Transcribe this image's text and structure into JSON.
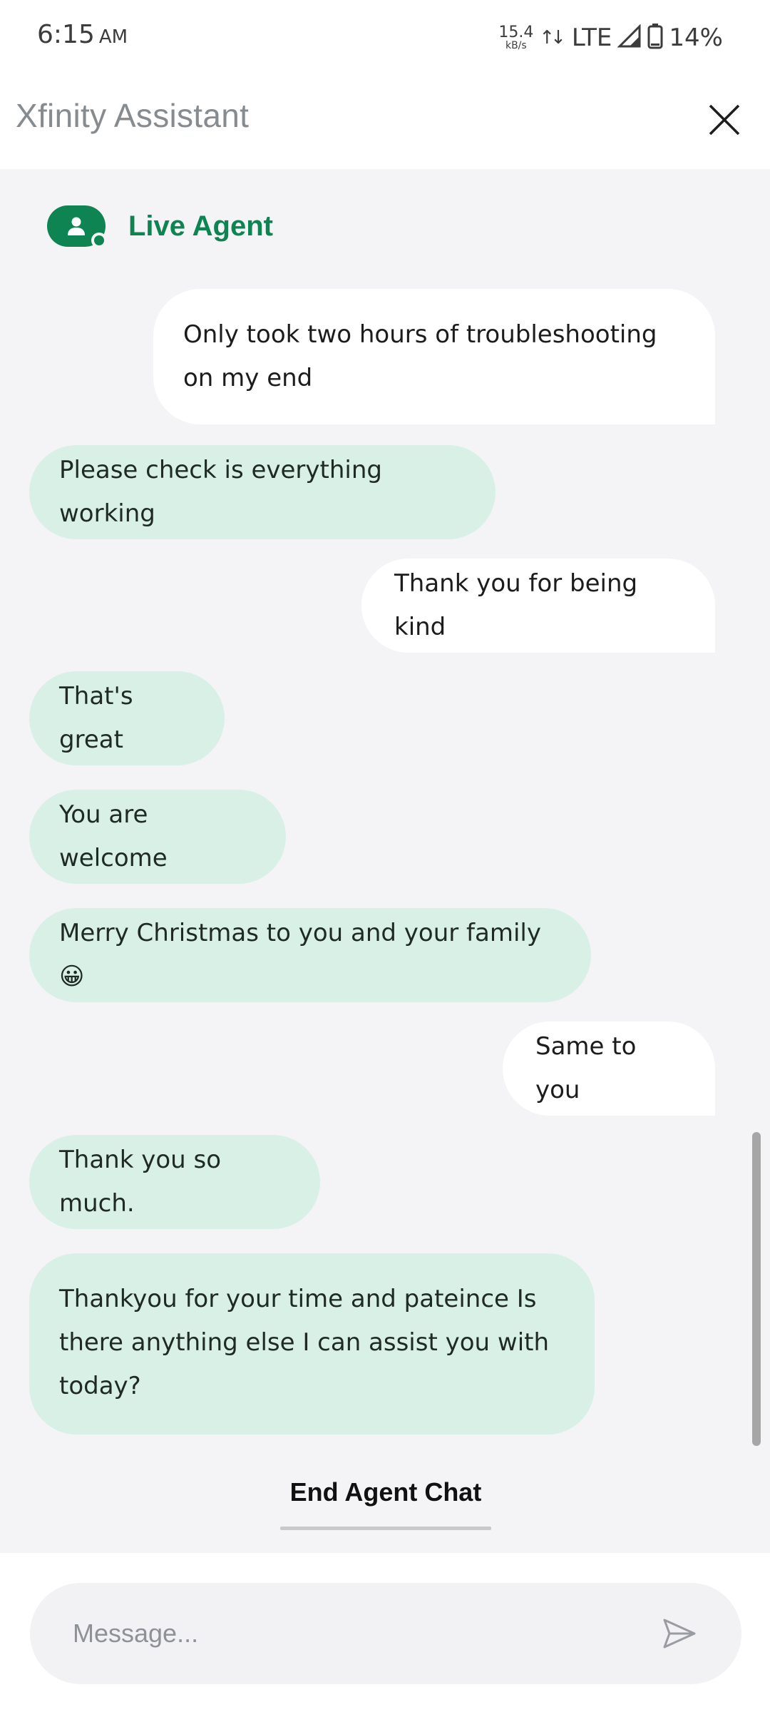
{
  "status_bar": {
    "time": "6:15",
    "ampm": "AM",
    "net_speed_value": "15.4",
    "net_speed_unit": "kB/s",
    "network": "LTE",
    "battery": "14%"
  },
  "header": {
    "title": "Xfinity Assistant",
    "close_icon": "close-icon"
  },
  "agent": {
    "label": "Live Agent",
    "avatar_icon": "person-icon",
    "brand_color": "#0d8451"
  },
  "messages": [
    {
      "from": "user",
      "lines": [
        "Only took two hours of troubleshooting",
        "on my end"
      ]
    },
    {
      "from": "agent",
      "lines": [
        "Please check is everything working"
      ]
    },
    {
      "from": "user",
      "lines": [
        "Thank you for being kind"
      ]
    },
    {
      "from": "agent",
      "lines": [
        "That's great"
      ]
    },
    {
      "from": "agent",
      "lines": [
        "You are welcome"
      ]
    },
    {
      "from": "agent",
      "lines": [
        "Merry Christmas to you and your family 😀"
      ]
    },
    {
      "from": "user",
      "lines": [
        "Same to you"
      ]
    },
    {
      "from": "agent",
      "lines": [
        "Thank you so much."
      ]
    },
    {
      "from": "agent",
      "lines": [
        "Thankyou for your time and pateince Is",
        "there anything else I can assist you with",
        "today?"
      ]
    }
  ],
  "end_chat": {
    "label": "End Agent Chat"
  },
  "composer": {
    "placeholder": "Message...",
    "value": "",
    "send_icon": "send-icon"
  }
}
